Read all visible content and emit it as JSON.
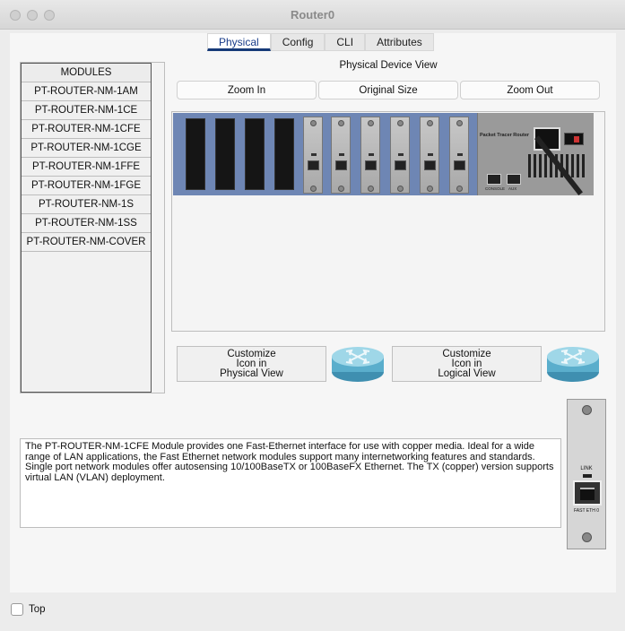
{
  "window": {
    "title": "Router0"
  },
  "tabs": [
    {
      "label": "Physical",
      "active": true
    },
    {
      "label": "Config",
      "active": false
    },
    {
      "label": "CLI",
      "active": false
    },
    {
      "label": "Attributes",
      "active": false
    }
  ],
  "modules": {
    "header": "MODULES",
    "items": [
      "PT-ROUTER-NM-1AM",
      "PT-ROUTER-NM-1CE",
      "PT-ROUTER-NM-1CFE",
      "PT-ROUTER-NM-1CGE",
      "PT-ROUTER-NM-1FFE",
      "PT-ROUTER-NM-1FGE",
      "PT-ROUTER-NM-1S",
      "PT-ROUTER-NM-1SS",
      "PT-ROUTER-NM-COVER"
    ]
  },
  "physical_view": {
    "label": "Physical Device View",
    "zoom_in": "Zoom In",
    "original_size": "Original Size",
    "zoom_out": "Zoom Out",
    "psu_title": "Packet Tracer Router",
    "console_label": "CONSOLE",
    "aux_label": "AUX"
  },
  "customize": {
    "physical_button": [
      "Customize",
      "Icon in",
      "Physical View"
    ],
    "logical_button": [
      "Customize",
      "Icon in",
      "Logical View"
    ]
  },
  "description": "The PT-ROUTER-NM-1CFE Module provides one Fast-Ethernet interface for use with copper media. Ideal for a wide range of LAN applications, the Fast Ethernet network modules support many internetworking features and standards. Single port network modules offer autosensing 10/100BaseTX or 100BaseFX Ethernet. The TX (copper) version supports virtual LAN (VLAN) deployment.",
  "module_preview": {
    "link_label": "LINK",
    "port_label": "FAST ETH 0"
  },
  "footer": {
    "top_label": "Top"
  }
}
